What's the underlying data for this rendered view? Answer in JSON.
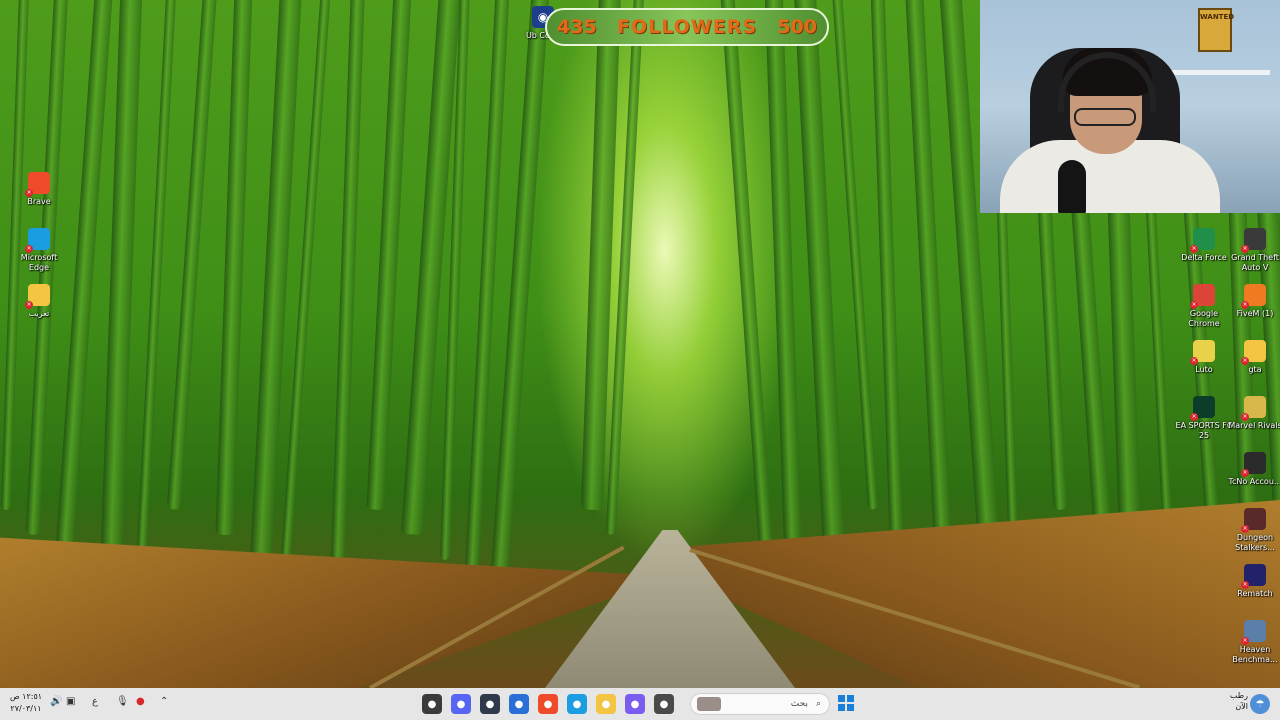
{
  "overlay": {
    "followers_current": "435",
    "followers_label": "FOLLOWERS",
    "followers_goal": "500",
    "goal_progress": 0.87
  },
  "webcam": {
    "poster_text": "WANTED"
  },
  "desktop_left": [
    {
      "label": "Brave",
      "icon": "brave-icon",
      "color": "#ef4b2a"
    },
    {
      "label": "Microsoft Edge",
      "icon": "edge-icon",
      "color": "#1b9de2"
    },
    {
      "label": "تعريب",
      "icon": "folder-icon",
      "color": "#f4c542"
    }
  ],
  "desktop_top_partial": {
    "label": "Ub Conn",
    "icon": "ubisoft-connect-icon"
  },
  "desktop_right": [
    {
      "label": "Delta Force",
      "icon": "delta-force-icon",
      "color": "#1f8f4a"
    },
    {
      "label": "Grand Theft Auto V",
      "icon": "gta-v-icon",
      "color": "#3a3a3a"
    },
    {
      "label": "Google Chrome",
      "icon": "chrome-icon",
      "color": "#db4437"
    },
    {
      "label": "FiveM (1)",
      "icon": "fivem-icon",
      "color": "#f07a22"
    },
    {
      "label": "Luto",
      "icon": "luto-icon",
      "color": "#e9d24a"
    },
    {
      "label": "gta",
      "icon": "folder-icon",
      "color": "#f4c542"
    },
    {
      "label": "EA SPORTS FC 25",
      "icon": "ea-fc-icon",
      "color": "#0c3d2a"
    },
    {
      "label": "Marvel Rivals",
      "icon": "marvel-rivals-icon",
      "color": "#d8b84a"
    },
    {
      "label": "TcNo Accou...",
      "icon": "tcno-icon",
      "color": "#2b2b2b"
    },
    {
      "label": "Dungeon Stalkers...",
      "icon": "dungeon-stalkers-icon",
      "color": "#5a2a2a"
    },
    {
      "label": "Rematch",
      "icon": "rematch-icon",
      "color": "#22226a"
    },
    {
      "label": "Heaven Benchma...",
      "icon": "heaven-benchmark-icon",
      "color": "#5b7fa8"
    }
  ],
  "taskbar": {
    "time": "١٢:٥١ ص",
    "date": "٢٧/٠٣/١١",
    "lang": "ع",
    "search_placeholder": "بحث",
    "weather_label": "رطب",
    "weather_sub": "الآن",
    "apps": [
      {
        "icon": "obs-icon",
        "color": "#3b3b3b"
      },
      {
        "icon": "discord-icon",
        "color": "#5865f2"
      },
      {
        "icon": "app-icon",
        "color": "#2f3a4a"
      },
      {
        "icon": "store-icon",
        "color": "#2a6fd6"
      },
      {
        "icon": "brave-icon",
        "color": "#ef4b2a"
      },
      {
        "icon": "edge-icon",
        "color": "#1b9de2"
      },
      {
        "icon": "file-explorer-icon",
        "color": "#f4c542"
      },
      {
        "icon": "copilot-icon",
        "color": "#7b5cf0"
      },
      {
        "icon": "task-view-icon",
        "color": "#4a4a4a"
      }
    ]
  }
}
